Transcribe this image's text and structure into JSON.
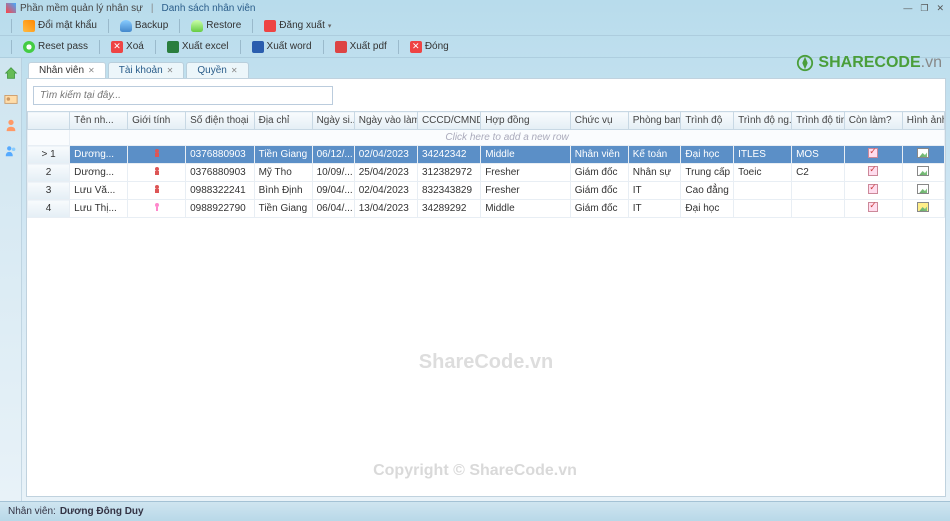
{
  "window": {
    "title": "Phần mềm quản lý nhân sự",
    "tab_title": "Danh sách nhân viên"
  },
  "toolbar1": {
    "change_pw": "Đổi mật khẩu",
    "backup": "Backup",
    "restore": "Restore",
    "logout": "Đăng xuất"
  },
  "toolbar2": {
    "reset_pass": "Reset pass",
    "delete": "Xoá",
    "export_excel": "Xuất excel",
    "export_word": "Xuất word",
    "export_pdf": "Xuất pdf",
    "close": "Đóng"
  },
  "brand": {
    "name": "SHARECODE",
    "ext": ".vn"
  },
  "tabs": [
    {
      "key": "nv",
      "label": "Nhân viên",
      "active": true
    },
    {
      "key": "tk",
      "label": "Tài khoản",
      "active": false
    },
    {
      "key": "q",
      "label": "Quyền",
      "active": false
    }
  ],
  "search": {
    "placeholder": "Tìm kiếm tại đây..."
  },
  "grid": {
    "headers": [
      "",
      "Tên nh...",
      "Giới tính",
      "Số điện thoại",
      "Địa chỉ",
      "Ngày si...",
      "Ngày vào làm",
      "CCCD/CMND",
      "Hợp đồng",
      "Chức vụ",
      "Phòng ban",
      "Trình độ",
      "Trình độ ng...",
      "Trình độ tin...",
      "Còn làm?",
      "Hình ảnh"
    ],
    "new_row_text": "Click here to add a new row",
    "rows": [
      {
        "idx": "> 1",
        "selected": true,
        "name": "Dương...",
        "gender": "m",
        "phone": "0376880903",
        "addr": "Tiền Giang",
        "birth": "06/12/...",
        "join": "02/04/2023",
        "id": "34242342",
        "contract": "Middle",
        "pos": "Nhân viên",
        "dept": "Kế toán",
        "edu": "Đại học",
        "fl": "ITLES",
        "it": "MOS",
        "working": true,
        "img": "normal"
      },
      {
        "idx": "2",
        "selected": false,
        "name": "Dương...",
        "gender": "m",
        "phone": "0376880903",
        "addr": "Mỹ Tho",
        "birth": "10/09/...",
        "join": "25/04/2023",
        "id": "312382972",
        "contract": "Fresher",
        "pos": "Giám đốc",
        "dept": "Nhân sự",
        "edu": "Trung cấp",
        "fl": "Toeic",
        "it": "C2",
        "working": true,
        "img": "normal"
      },
      {
        "idx": "3",
        "selected": false,
        "name": "Lưu Vă...",
        "gender": "m",
        "phone": "0988322241",
        "addr": "Bình Định",
        "birth": "09/04/...",
        "join": "02/04/2023",
        "id": "832343829",
        "contract": "Fresher",
        "pos": "Giám đốc",
        "dept": "IT",
        "edu": "Cao đẳng",
        "fl": "",
        "it": "",
        "working": true,
        "img": "normal"
      },
      {
        "idx": "4",
        "selected": false,
        "name": "Lưu Thị...",
        "gender": "f",
        "phone": "0988922790",
        "addr": "Tiền Giang",
        "birth": "06/04/...",
        "join": "13/04/2023",
        "id": "34289292",
        "contract": "Middle",
        "pos": "Giám đốc",
        "dept": "IT",
        "edu": "Đại học",
        "fl": "",
        "it": "",
        "working": true,
        "img": "warn"
      }
    ]
  },
  "watermark": "ShareCode.vn",
  "watermark_copy": "Copyright © ShareCode.vn",
  "statusbar": {
    "label": "Nhân viên:",
    "value": "Dương Đông Duy"
  }
}
